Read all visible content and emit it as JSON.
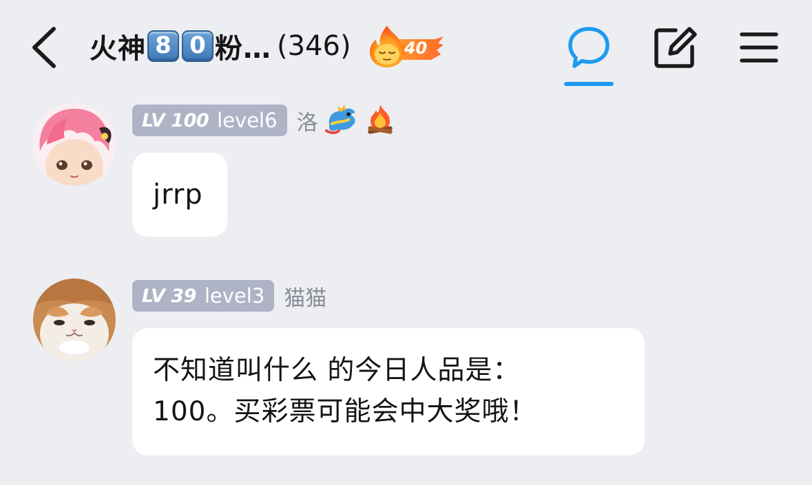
{
  "header": {
    "back_icon": "chevron-left-icon",
    "title_prefix": "火神",
    "title_key1": "8",
    "title_key2": "0",
    "title_suffix": "粉…",
    "member_count": "(346)",
    "fire_level": "40",
    "icons": [
      "chat-bubble-icon",
      "edit-icon",
      "menu-icon"
    ],
    "active_color": "#1f9af0"
  },
  "messages": [
    {
      "avatar": "pink-hair-anime-avatar",
      "level": "LV 100",
      "level_title": "level6",
      "sender": "洛",
      "emojis": [
        "dragon-icon",
        "campfire-icon"
      ],
      "text": "jrrp"
    },
    {
      "avatar": "cat-avatar",
      "level": "LV 39",
      "level_title": "level3",
      "sender": "猫猫",
      "text_line1": "不知道叫什么 的今日人品是：",
      "text_line2": "100。买彩票可能会中大奖哦！"
    }
  ],
  "colors": {
    "background": "#edeef2",
    "bubble": "#ffffff",
    "level_badge": "#aeb3c6",
    "sender_name": "#8a8d98"
  }
}
